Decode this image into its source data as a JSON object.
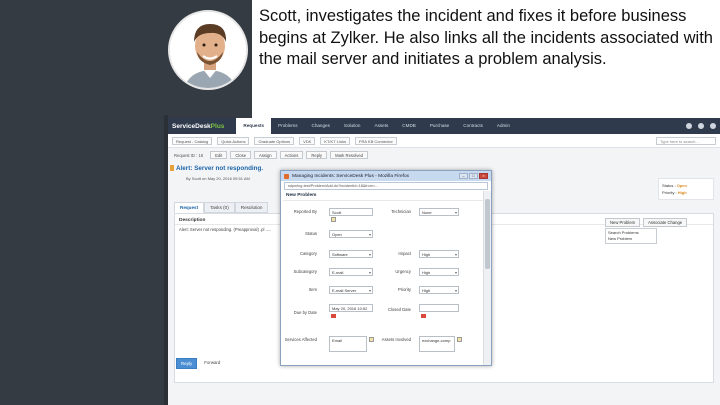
{
  "caption": "Scott, investigates the incident and fixes it before business begins at Zylker. He also links all the incidents associated with the mail server and initiates a problem analysis.",
  "app": {
    "logo_main": "ServiceDesk",
    "logo_plus": "Plus",
    "nav": [
      "Requests",
      "Problems",
      "Changes",
      "Solution",
      "Assets",
      "CMDB",
      "Purchase",
      "Contracts",
      "Admin"
    ],
    "search_placeholder": "Type here to search...",
    "toolbar2": [
      "Request - Catalog",
      "Quick Actions",
      "Graduate Options",
      "VDK",
      "KT/KT Links",
      "FRA KB Connector"
    ],
    "request_id_label": "Request ID : 18",
    "request_buttons": [
      "Edit",
      "Close",
      "Assign",
      "Actions",
      "Reply",
      "Mark Resolved"
    ],
    "subject": "Alert: Server not responding.",
    "byline": "By Scott  on May 20, 2016 09:51 AM",
    "status_label": "Status :",
    "status_value": "Open",
    "priority_label": "Priority :",
    "priority_value": "High",
    "tabs": [
      "Request",
      "Tasks (0)",
      "Resolution"
    ],
    "desc_title": "Description",
    "desc_text": "Alert: Server not responding. (Preapproval) .pl .....",
    "side_buttons": [
      "New Problem",
      "Associate Change"
    ],
    "dropdown_items": [
      "Search Problems",
      "New Problem"
    ],
    "reply_label": "Reply",
    "forward_label": "Forward"
  },
  "modal": {
    "title": "Managing Incidents: ServiceDesk Plus - Mozilla Firefox",
    "url": "sdpmlng-test/Problem/Add.do?incidentId=18&from=...",
    "section_title": "New Problem",
    "fields": {
      "reported_by_label": "Reported By",
      "reported_by_value": "Scott",
      "technician_label": "Technician",
      "technician_value": "None",
      "status_label": "Status",
      "status_value": "Open",
      "category_label": "Category",
      "category_value": "Software",
      "impact_label": "Impact",
      "impact_value": "High",
      "subcategory_label": "Subcategory",
      "subcategory_value": "E-mail",
      "urgency_label": "Urgency",
      "urgency_value": "High",
      "item_label": "Item",
      "item_value": "E-mail Server",
      "priority_label": "Priority",
      "priority_value": "High",
      "duedate_label": "Due by Date",
      "duedate_value": "May 20, 2016 10:52",
      "closed_label": "Closed Date",
      "services_label": "Services Affected",
      "services_value": "Email",
      "assets_label": "Assets Involved",
      "assets_value": "exchange-comp"
    }
  }
}
